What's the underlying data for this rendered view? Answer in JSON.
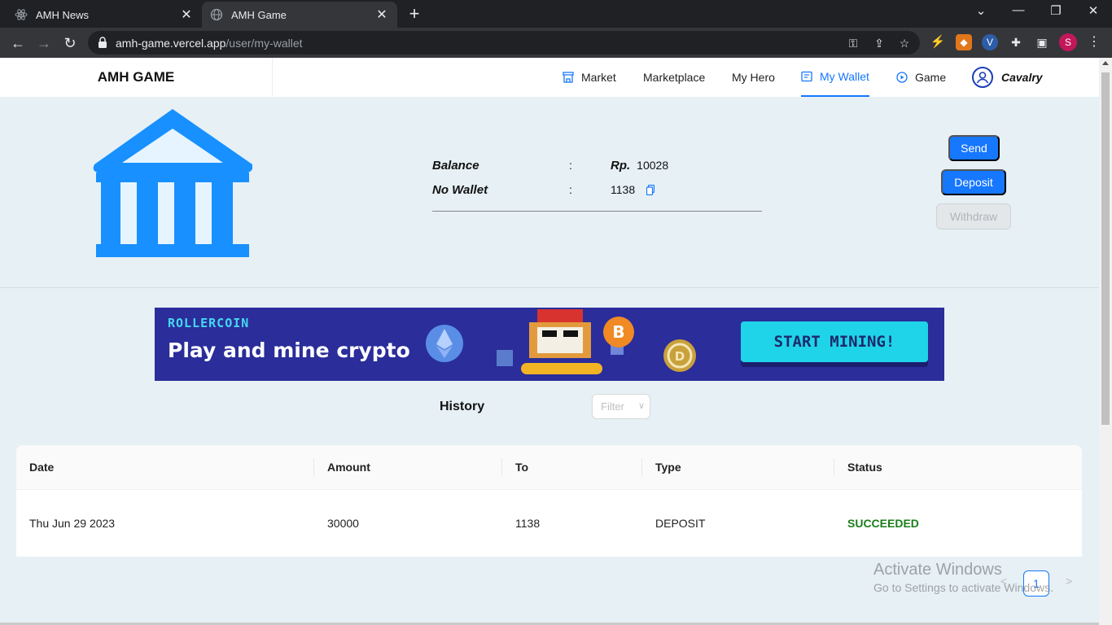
{
  "browser": {
    "tabs": [
      {
        "title": "AMH News",
        "active": false
      },
      {
        "title": "AMH Game",
        "active": true
      }
    ],
    "url_host": "amh-game.vercel.app",
    "url_path": "/user/my-wallet",
    "profile_initial": "S"
  },
  "app": {
    "brand": "AMH GAME",
    "nav": [
      {
        "label": "Market",
        "icon": "shop-icon"
      },
      {
        "label": "Marketplace"
      },
      {
        "label": "My Hero"
      },
      {
        "label": "My Wallet",
        "icon": "wallet-icon",
        "active": true
      },
      {
        "label": "Game",
        "icon": "play-circle-icon"
      }
    ],
    "user": "Cavalry"
  },
  "wallet": {
    "balance_label": "Balance",
    "wallet_label": "No Wallet",
    "colon": ":",
    "currency": "Rp.",
    "balance": "10028",
    "wallet_no": "1138",
    "send_label": "Send",
    "deposit_label": "Deposit",
    "withdraw_label": "Withdraw"
  },
  "banner": {
    "brand": "ROLLERCOIN",
    "tagline": "Play and mine crypto",
    "cta": "START MINING!"
  },
  "history": {
    "title": "History",
    "filter_placeholder": "Filter",
    "columns": [
      "Date",
      "Amount",
      "To",
      "Type",
      "Status"
    ],
    "rows": [
      {
        "date": "Thu Jun 29 2023",
        "amount": "30000",
        "to": "1138",
        "type": "DEPOSIT",
        "status": "SUCCEEDED"
      }
    ],
    "page": "1"
  },
  "watermark": {
    "line1": "Activate Windows",
    "line2": "Go to Settings to activate Windows."
  },
  "colors": {
    "primary": "#1677ff",
    "bank_icon": "#1890ff",
    "success": "#1a7f1a",
    "background": "#e6f0f5"
  }
}
